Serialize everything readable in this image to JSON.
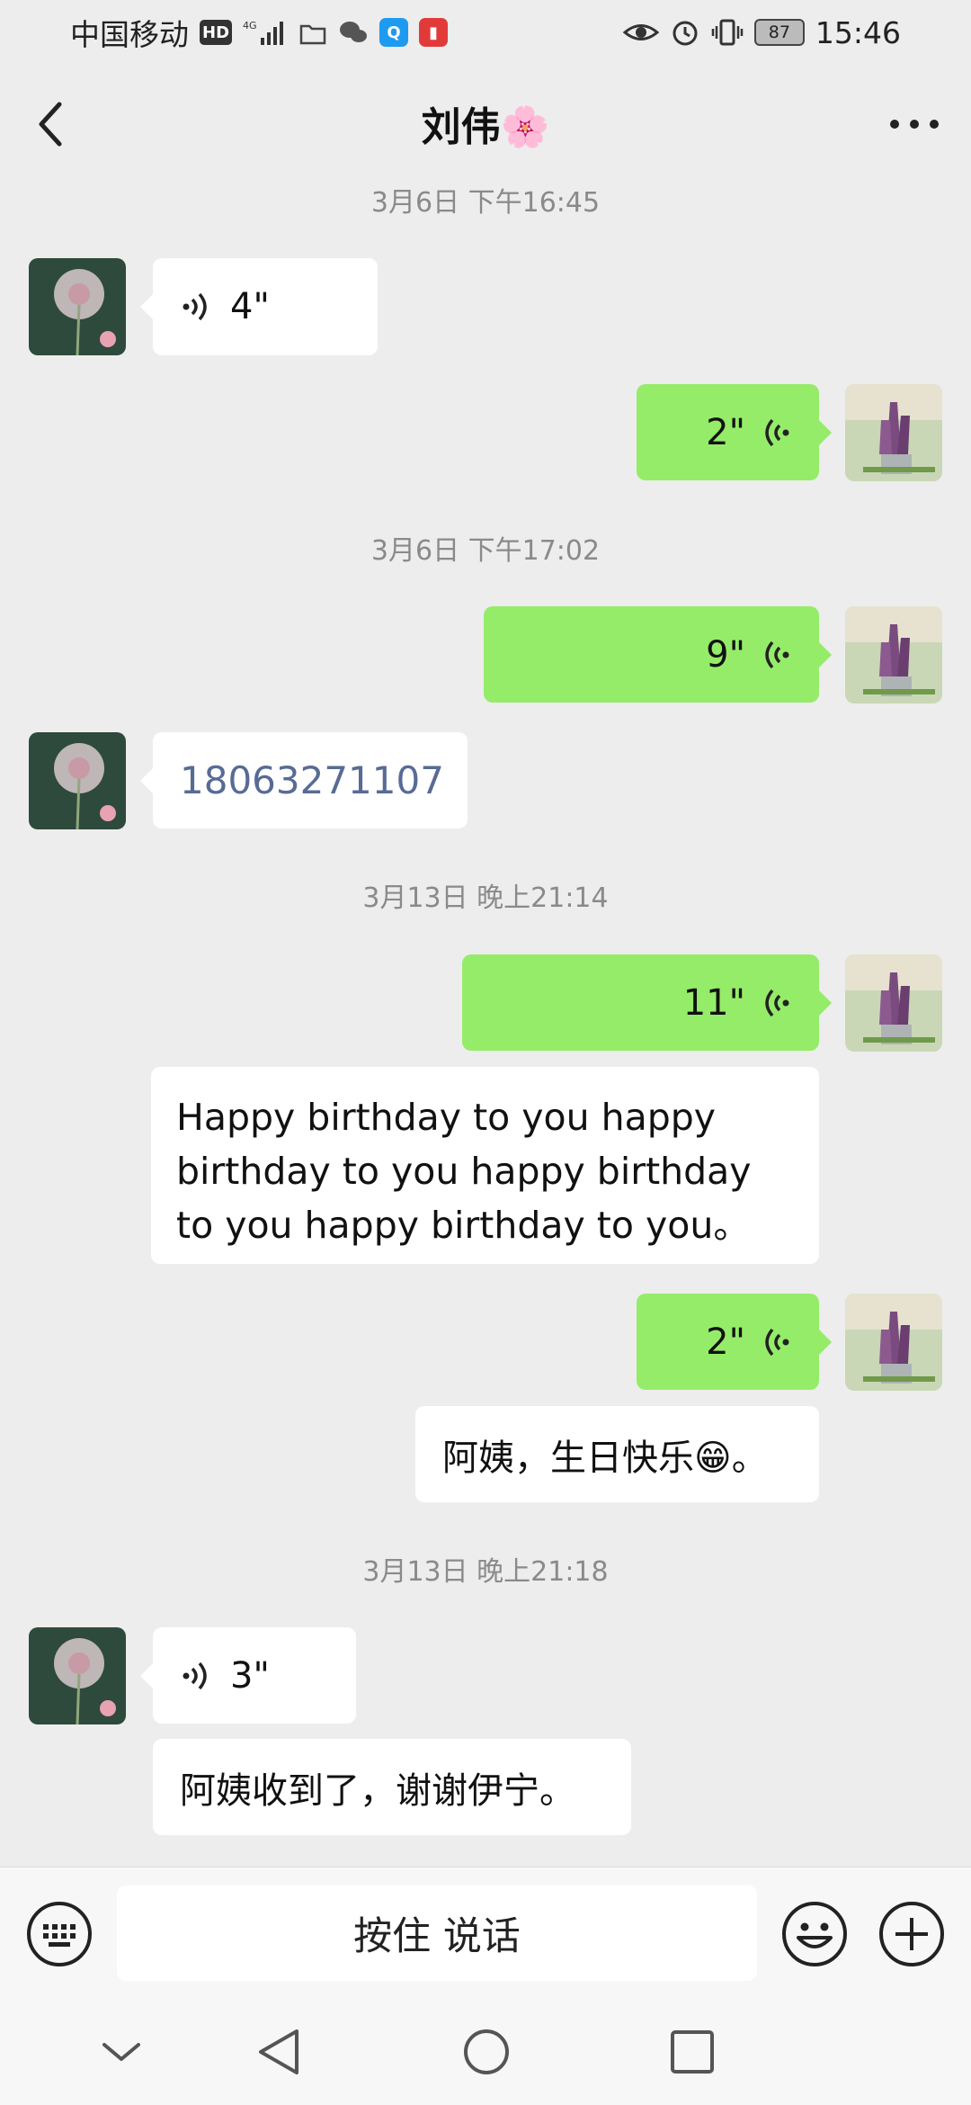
{
  "status_bar": {
    "carrier": "中国移动",
    "hd": "HD",
    "battery": "87",
    "time": "15:46"
  },
  "header": {
    "title": "刘伟🌸"
  },
  "messages": [
    {
      "type": "time",
      "text": "3月6日 下午16:45"
    },
    {
      "type": "voice",
      "from": "other",
      "duration": "4\""
    },
    {
      "type": "voice",
      "from": "me",
      "duration": "2\""
    },
    {
      "type": "time",
      "text": "3月6日 下午17:02"
    },
    {
      "type": "voice",
      "from": "me",
      "duration": "9\""
    },
    {
      "type": "text",
      "from": "other",
      "text": "18063271107"
    },
    {
      "type": "time",
      "text": "3月13日 晚上21:14"
    },
    {
      "type": "voice",
      "from": "me",
      "duration": "11\""
    },
    {
      "type": "text",
      "from": "me",
      "text": "Happy birthday to you happy birthday to you happy birthday to you happy birthday to you。"
    },
    {
      "type": "voice",
      "from": "me",
      "duration": "2\""
    },
    {
      "type": "text",
      "from": "me",
      "text": "阿姨，生日快乐😁。"
    },
    {
      "type": "time",
      "text": "3月13日 晚上21:18"
    },
    {
      "type": "voice",
      "from": "other",
      "duration": "3\""
    },
    {
      "type": "text",
      "from": "other",
      "text": "阿姨收到了，谢谢伊宁。"
    }
  ],
  "input_bar": {
    "hold_to_talk": "按住 说话"
  },
  "colors": {
    "background": "#ededed",
    "bubble_sent": "#95ec69",
    "bubble_received": "#ffffff",
    "link_number": "#576b95"
  }
}
